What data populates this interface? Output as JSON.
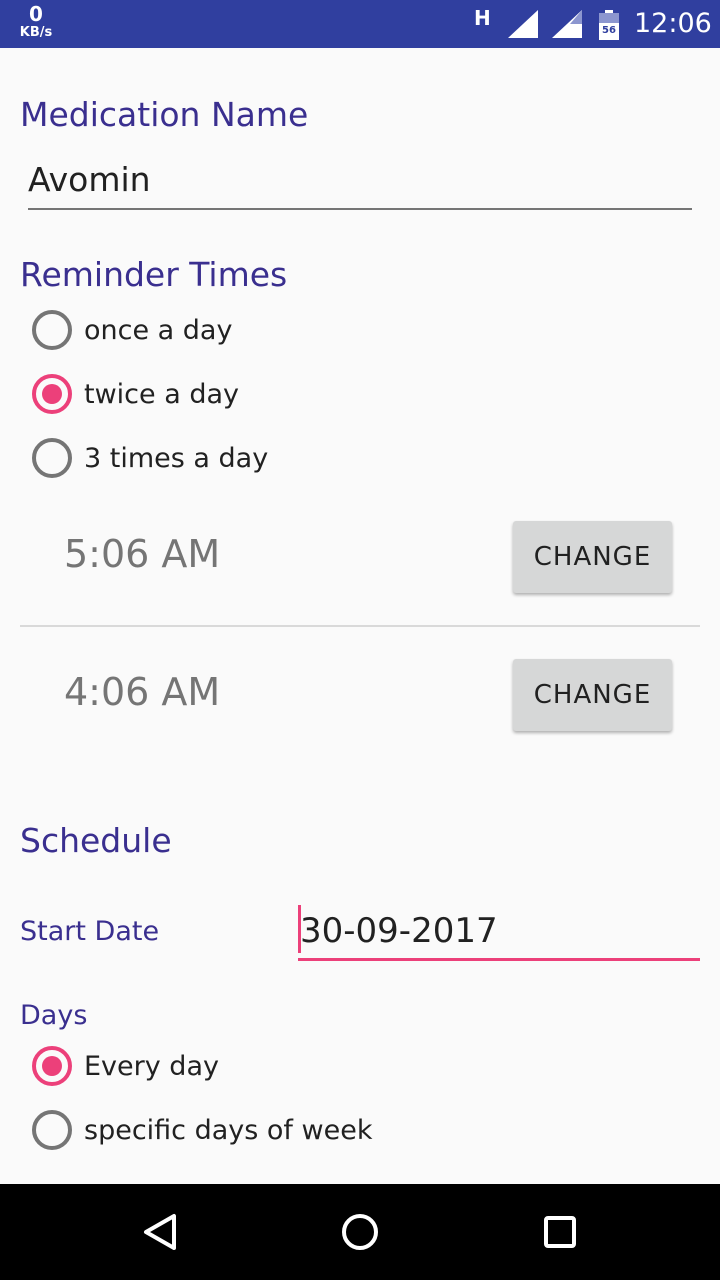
{
  "status_bar": {
    "net_speed_value": "0",
    "net_speed_unit": "KB/s",
    "network_type": "H",
    "battery_level": "56",
    "time": "12:06",
    "icons": [
      "signal-icon",
      "signal-icon",
      "battery-icon"
    ]
  },
  "form": {
    "medication_title": "Medication Name",
    "medication_value": "Avomin",
    "reminder_title": "Reminder Times",
    "reminder_options": [
      {
        "label": "once a day",
        "checked": false
      },
      {
        "label": "twice a day",
        "checked": true
      },
      {
        "label": "3 times a day",
        "checked": false
      }
    ],
    "times": [
      {
        "time": "5:06 AM",
        "button": "CHANGE"
      },
      {
        "time": "4:06 AM",
        "button": "CHANGE"
      }
    ],
    "schedule_title": "Schedule",
    "start_date_label": "Start Date",
    "start_date_value": "30-09-2017",
    "days_label": "Days",
    "days_options": [
      {
        "label": "Every day",
        "checked": true
      },
      {
        "label": "specific days of week",
        "checked": false
      }
    ]
  },
  "nav_bar": {
    "icons": [
      "back-icon",
      "home-icon",
      "recent-apps-icon"
    ]
  },
  "colors": {
    "status_bar": "#303f9f",
    "accent": "#ec407a",
    "section_title": "#3a2f8f",
    "button_bg": "#d6d7d7"
  }
}
